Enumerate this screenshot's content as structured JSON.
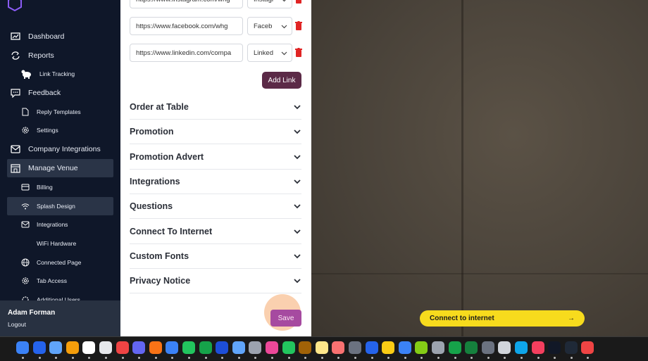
{
  "sidebar": {
    "items": [
      {
        "label": "Dashboard",
        "icon": "chart-icon"
      },
      {
        "label": "Reports",
        "icon": "refresh-icon"
      },
      {
        "label": "Link Tracking",
        "icon": "cow-icon"
      },
      {
        "label": "Feedback",
        "icon": "chat-icon"
      },
      {
        "label": "Reply Templates",
        "icon": "document-icon"
      },
      {
        "label": "Settings",
        "icon": "gear-icon"
      },
      {
        "label": "Company Integrations",
        "icon": "mail-icon"
      },
      {
        "label": "Manage Venue",
        "icon": "building-icon"
      },
      {
        "label": "Billing",
        "icon": "card-icon"
      },
      {
        "label": "Splash Design",
        "icon": "wifi-icon"
      },
      {
        "label": "Integrations",
        "icon": "mail-icon"
      },
      {
        "label": "WiFi Hardware",
        "icon": "hardware-icon"
      },
      {
        "label": "Connected Page",
        "icon": "globe-icon"
      },
      {
        "label": "Tab Access",
        "icon": "gear-icon"
      },
      {
        "label": "Additional Users",
        "icon": "gear-icon"
      }
    ],
    "user_name": "Adam Forman",
    "logout_label": "Logout"
  },
  "panel": {
    "links": [
      {
        "url": "https://www.instagram.com/whg",
        "type": "Instagr"
      },
      {
        "url": "https://www.facebook.com/whg",
        "type": "Faceb"
      },
      {
        "url": "https://www.linkedin.com/compa",
        "type": "Linked"
      }
    ],
    "add_link_label": "Add Link",
    "sections": [
      "Order at Table",
      "Promotion",
      "Promotion Advert",
      "Integrations",
      "Questions",
      "Connect To Internet",
      "Custom Fonts",
      "Privacy Notice"
    ],
    "save_label": "Save"
  },
  "preview": {
    "connect_label": "Connect to internet",
    "connect_arrow": "→"
  },
  "colors": {
    "sidebar_bg": "#0f1729",
    "add_link_bg": "#5b2a47",
    "save_bg": "#a64aa0",
    "connect_bg": "#f7db1d",
    "trash": "#e02424"
  }
}
